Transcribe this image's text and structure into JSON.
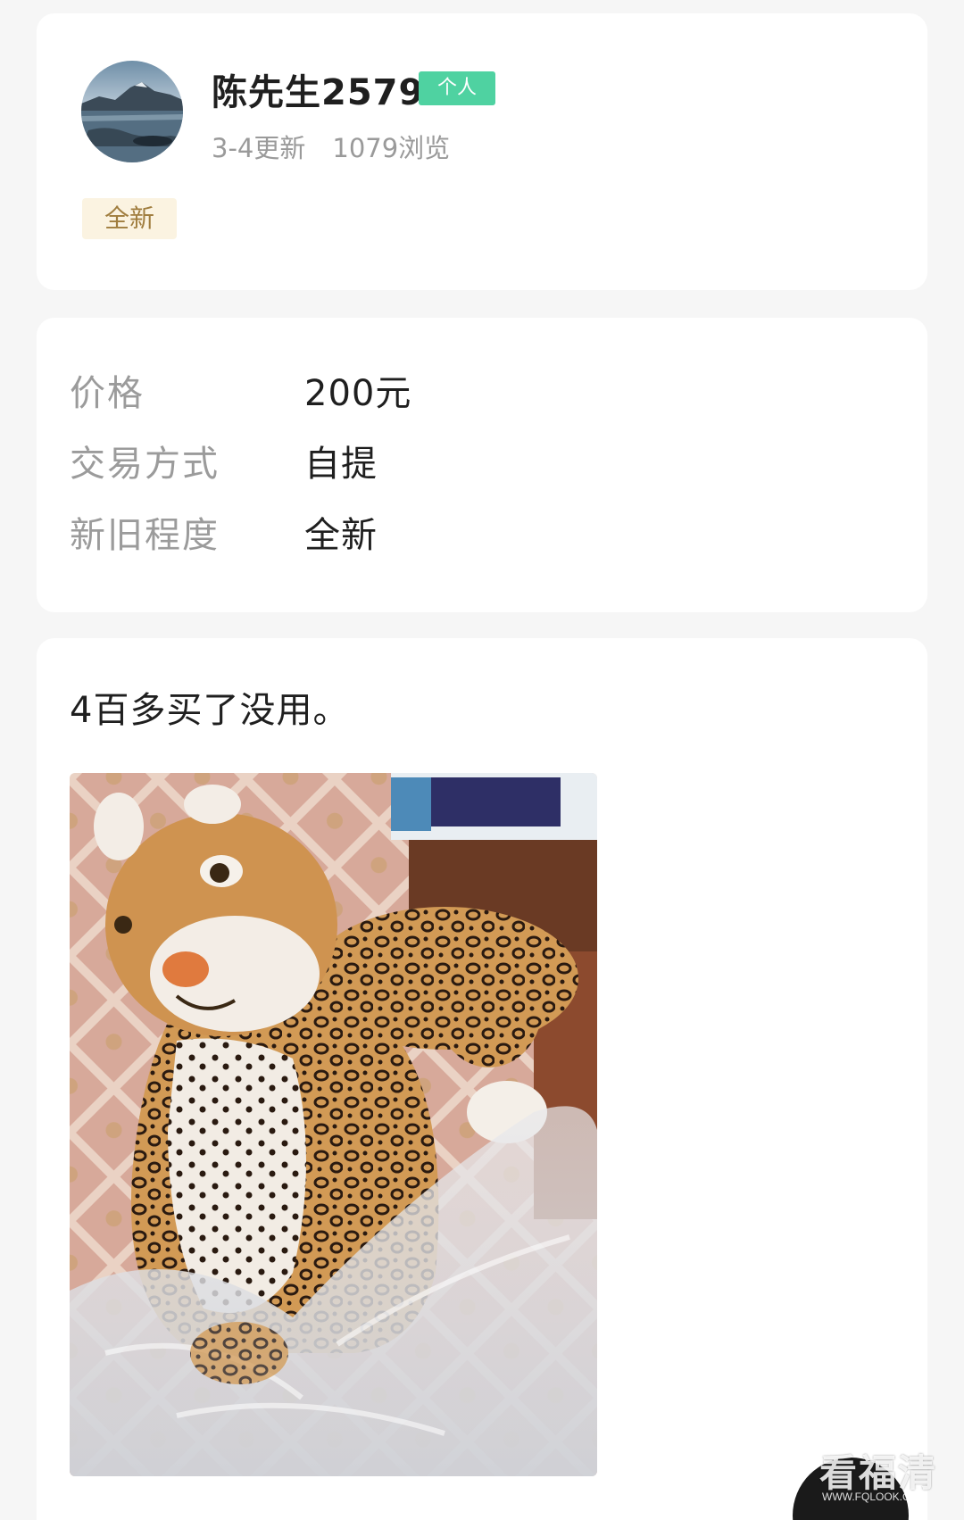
{
  "seller": {
    "name": "陈先生2579",
    "badge": "个人",
    "updated": "3-4更新",
    "views": "1079浏览",
    "condition_tag": "全新"
  },
  "details": {
    "rows": [
      {
        "label": "价格",
        "value": "200元"
      },
      {
        "label": "交易方式",
        "value": "自提"
      },
      {
        "label": "新旧程度",
        "value": "全新"
      }
    ]
  },
  "description": {
    "text": "4百多买了没用。",
    "photo_subject": "leopard plush toy"
  },
  "watermark": {
    "text": "看福清",
    "url": "WWW.FQLOOK.COM"
  },
  "colors": {
    "badge_green": "#4fd2a1",
    "tag_bg": "#fbf3e1",
    "tag_text": "#a07d3e"
  }
}
